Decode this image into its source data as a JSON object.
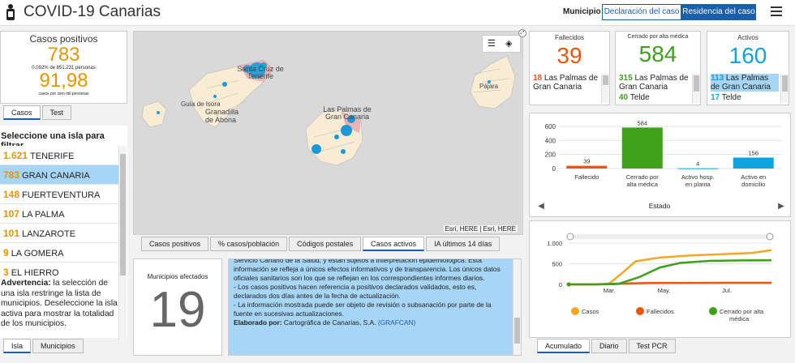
{
  "header": {
    "title": "COVID-19 Canarias",
    "municipio_label": "Municipio",
    "btn_declaracion": "Declaración del caso",
    "btn_residencia": "Residencia del caso"
  },
  "left": {
    "casos_title": "Casos positivos",
    "casos_value": "783",
    "casos_pct": "0.092% de 851.231 personas",
    "rate_value": "91,98",
    "rate_label": "casos por cien mil personas",
    "tab_casos": "Casos",
    "tab_test": "Test",
    "select_title": "Seleccione una isla para filtrar",
    "islands": [
      {
        "n": "1.621",
        "name": "TENERIFE"
      },
      {
        "n": "783",
        "name": "GRAN CANARIA"
      },
      {
        "n": "148",
        "name": "FUERTEVENTURA"
      },
      {
        "n": "107",
        "name": "LA PALMA"
      },
      {
        "n": "101",
        "name": "LANZAROTE"
      },
      {
        "n": "9",
        "name": "LA GOMERA"
      },
      {
        "n": "3",
        "name": "EL HIERRO"
      }
    ],
    "warning_label": "Advertencia:",
    "warning_text": " la selección de una isla restringe la lista de municipios. Deseleccione la isla activa para mostrar la totalidad de los municipios.",
    "tab_isla": "Isla",
    "tab_municipios": "Municipios"
  },
  "map": {
    "labels": {
      "santa_cruz": "Santa Cruz de Tenerife",
      "guia": "Guía de Isora",
      "granadilla": "Granadilla de Abona",
      "las_palmas": "Las Palmas de Gran Canaria",
      "pajara": "Pájara"
    },
    "attribution": "Esri, HERE | Esri, HERE",
    "tabs": [
      "Casos positivos",
      "% casos/población",
      "Códigos postales",
      "Casos activos",
      "IA últimos 14 días"
    ]
  },
  "municipios": {
    "label": "Municipios afectados",
    "value": "19"
  },
  "info": {
    "p1": "Servicio Canario de la Salud, y están sujetos a interpretación epidemiológica. Esta información se refleja a únicos efectos informativos y de transparencia. Los únicos datos oficiales sanitarios son los que se reflejan en los correspondientes informes diarios.",
    "p2": "- Los casos positivos hacen referencia a positivos declarados validados, esto es, declarados dos días antes de la fecha de actualización.",
    "p3": "- La información mostrada puede ser objeto de revisión o subsanación por parte de la fuente en sucesivas actualizaciones.",
    "credit_label": "Elaborado por:",
    "credit_text": " Cartográfica de Canarias, S.A. ",
    "credit_link": "(GRAFCAN)"
  },
  "cards": {
    "fallecidos": {
      "title": "Fallecidos",
      "value": "39",
      "rows": [
        {
          "n": "18",
          "t": "Las Palmas de Gran Canaria"
        }
      ]
    },
    "cerrado": {
      "title": "Cerrado por alta médica",
      "value": "584",
      "rows": [
        {
          "n": "315",
          "t": "Las Palmas de Gran Canaria"
        },
        {
          "n": "40",
          "t": "Telde"
        }
      ]
    },
    "activos": {
      "title": "Activos",
      "value": "160",
      "rows": [
        {
          "n": "113",
          "t": "Las Palmas de Gran Canaria"
        },
        {
          "n": "17",
          "t": "Telde"
        }
      ]
    }
  },
  "colors": {
    "orange": "#e8560f",
    "green": "#3ea11a",
    "blue": "#11a3e0",
    "yellow": "#f5a623",
    "brand": "#1a5fa8"
  },
  "chart_data": [
    {
      "type": "bar",
      "categories": [
        "Fallecido",
        "Cerrado por alta médica",
        "Activo hosp. en planta",
        "Activo en domicilio"
      ],
      "values": [
        39,
        584,
        4,
        156
      ],
      "colors": [
        "#e8560f",
        "#3ea11a",
        "#11a3e0",
        "#11a3e0"
      ],
      "xlabel": "Estado",
      "ylim": [
        0,
        600
      ],
      "yticks": [
        0,
        200,
        400,
        600
      ]
    },
    {
      "type": "line",
      "x": [
        "Mar.",
        "May.",
        "Jul."
      ],
      "yticks": [
        "0",
        "500",
        "1.000"
      ],
      "ylim": [
        0,
        1000
      ],
      "series": [
        {
          "name": "Casos",
          "color": "#f5a623",
          "points": [
            [
              0,
              0
            ],
            [
              0.12,
              0
            ],
            [
              0.2,
              20
            ],
            [
              0.27,
              300
            ],
            [
              0.33,
              560
            ],
            [
              0.45,
              650
            ],
            [
              0.6,
              700
            ],
            [
              0.8,
              740
            ],
            [
              0.9,
              760
            ],
            [
              1.0,
              830
            ]
          ]
        },
        {
          "name": "Fallecidos",
          "color": "#e8560f",
          "points": [
            [
              0,
              0
            ],
            [
              0.12,
              0
            ],
            [
              0.22,
              5
            ],
            [
              0.3,
              25
            ],
            [
              0.4,
              35
            ],
            [
              0.6,
              38
            ],
            [
              1.0,
              39
            ]
          ]
        },
        {
          "name": "Cerrado por alta médica",
          "color": "#3ea11a",
          "points": [
            [
              0,
              0
            ],
            [
              0.14,
              0
            ],
            [
              0.25,
              20
            ],
            [
              0.35,
              180
            ],
            [
              0.45,
              410
            ],
            [
              0.55,
              520
            ],
            [
              0.7,
              570
            ],
            [
              0.85,
              580
            ],
            [
              1.0,
              584
            ]
          ]
        }
      ],
      "tabs": [
        "Acumulado",
        "Diario",
        "Test PCR"
      ]
    }
  ]
}
